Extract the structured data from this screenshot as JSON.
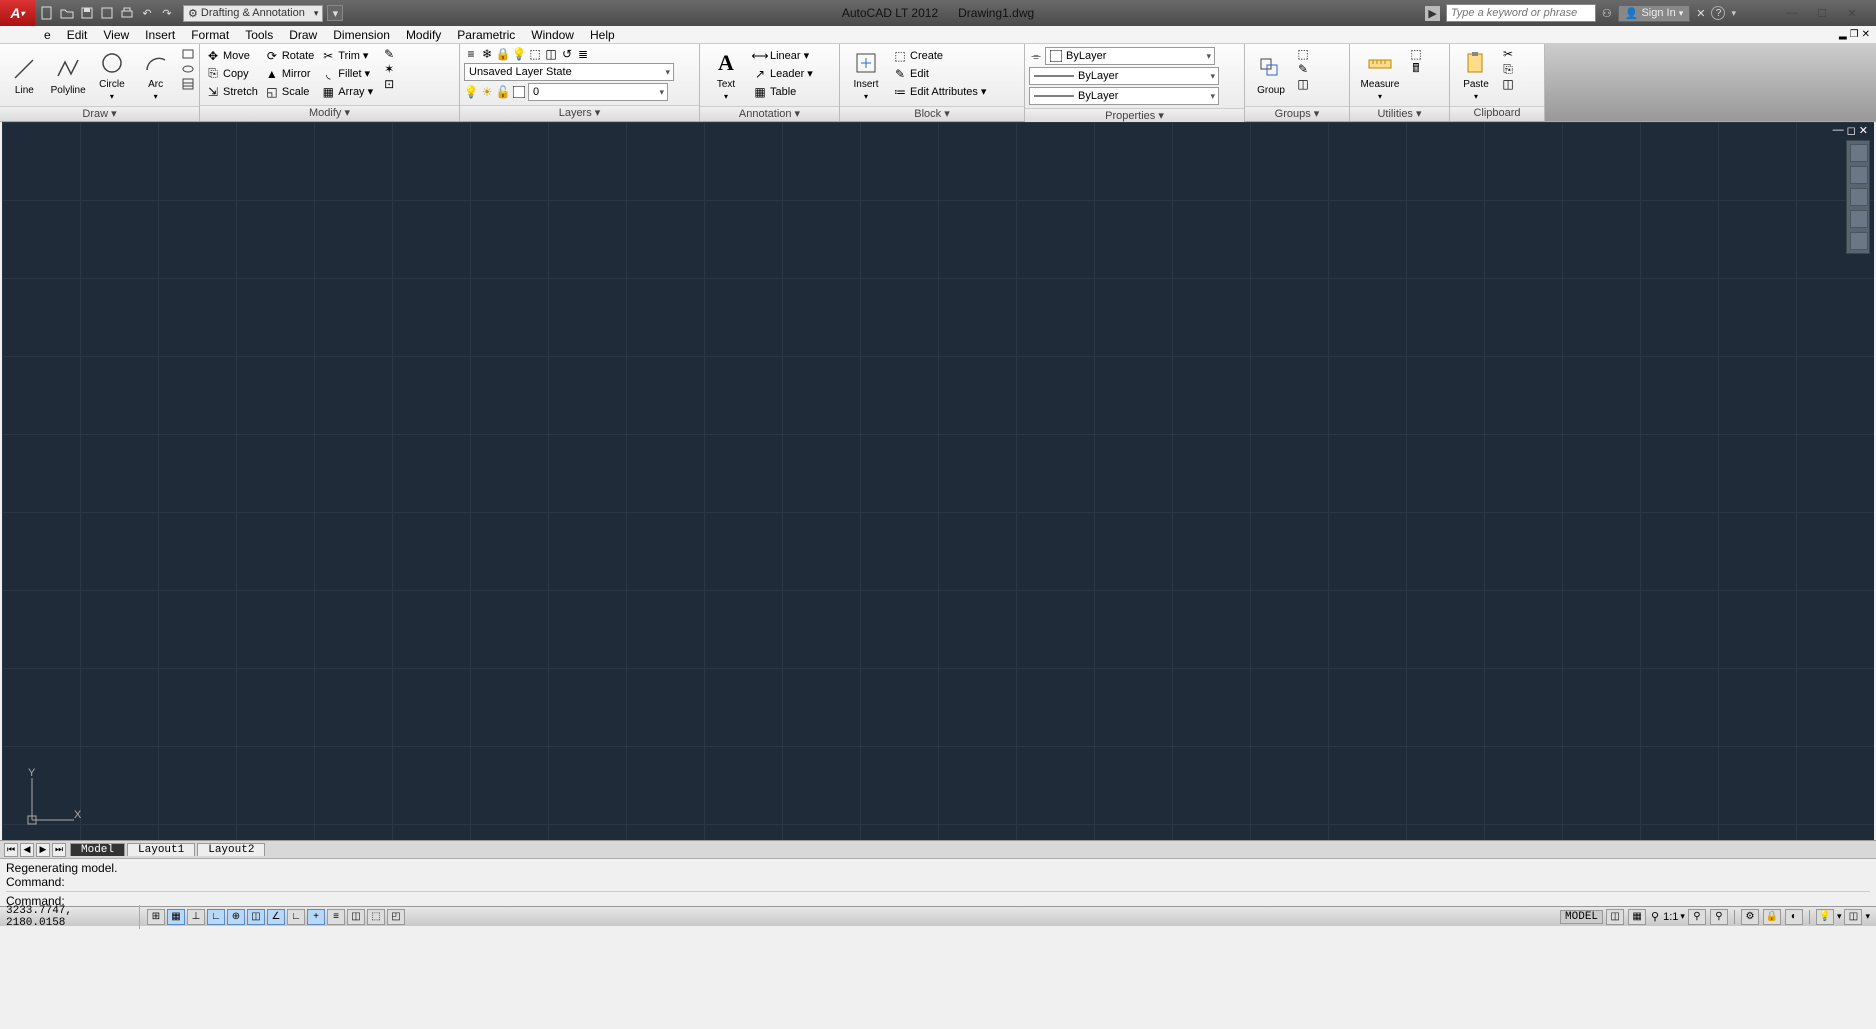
{
  "title": {
    "app": "AutoCAD LT 2012",
    "doc": "Drawing1.dwg"
  },
  "qat": {
    "workspace": "Drafting & Annotation"
  },
  "search": {
    "placeholder": "Type a keyword or phrase"
  },
  "sign_in": "Sign In",
  "menu": [
    "e",
    "Edit",
    "View",
    "Insert",
    "Format",
    "Tools",
    "Draw",
    "Dimension",
    "Modify",
    "Parametric",
    "Window",
    "Help"
  ],
  "ribbon": {
    "draw": {
      "title": "Draw ▾",
      "line": "Line",
      "polyline": "Polyline",
      "circle": "Circle",
      "arc": "Arc"
    },
    "modify": {
      "title": "Modify ▾",
      "move": "Move",
      "rotate": "Rotate",
      "trim": "Trim",
      "copy": "Copy",
      "mirror": "Mirror",
      "fillet": "Fillet",
      "stretch": "Stretch",
      "scale": "Scale",
      "array": "Array"
    },
    "layers": {
      "title": "Layers ▾",
      "state": "Unsaved Layer State",
      "current": "0"
    },
    "annotation": {
      "title": "Annotation ▾",
      "text": "Text",
      "linear": "Linear",
      "leader": "Leader",
      "table": "Table"
    },
    "block": {
      "title": "Block ▾",
      "insert": "Insert",
      "create": "Create",
      "edit": "Edit",
      "editattr": "Edit Attributes"
    },
    "properties": {
      "title": "Properties ▾",
      "bylayer1": "ByLayer",
      "bylayer2": "ByLayer",
      "bylayer3": "ByLayer"
    },
    "groups": {
      "title": "Groups ▾",
      "group": "Group"
    },
    "utilities": {
      "title": "Utilities ▾",
      "measure": "Measure"
    },
    "clipboard": {
      "title": "Clipboard",
      "paste": "Paste"
    }
  },
  "ucs": {
    "x": "X",
    "y": "Y"
  },
  "tabs": {
    "model": "Model",
    "layout1": "Layout1",
    "layout2": "Layout2"
  },
  "command": {
    "line1": "Regenerating model.",
    "line2": "Command:",
    "prompt": "Command:"
  },
  "status": {
    "coords": "3233.7747, 2180.0158",
    "model": "MODEL",
    "scale": "1:1"
  }
}
